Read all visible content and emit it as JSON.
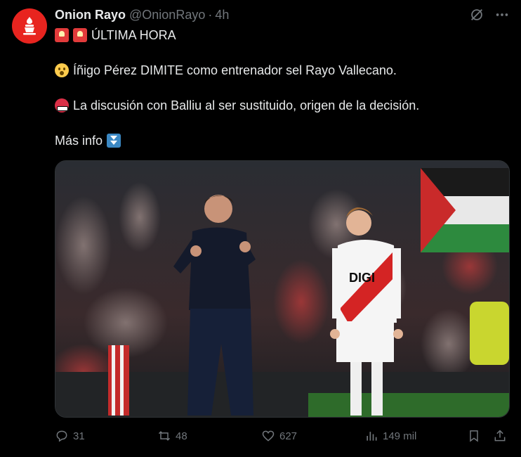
{
  "author": {
    "display_name": "Onion Rayo",
    "handle": "@OnionRayo",
    "separator": "·",
    "time": "4h",
    "avatar_color": "#e8241f"
  },
  "top_icons": [
    "grok-icon",
    "more-icon"
  ],
  "body": {
    "line1": "ÚLTIMA HORA",
    "line2": "Íñigo Pérez DIMITE como entrenador sel Rayo Vallecano.",
    "line3": "La discusión con Balliu al ser sustituido, origen de la decisión.",
    "line4": "Más info"
  },
  "media": {
    "shirt_text": "DIGI"
  },
  "actions": {
    "replies": "31",
    "retweets": "48",
    "likes": "627",
    "views": "149 mil"
  },
  "colors": {
    "background": "#000000",
    "text": "#e7e9ea",
    "muted": "#71767b",
    "brand_red": "#e8241f"
  }
}
